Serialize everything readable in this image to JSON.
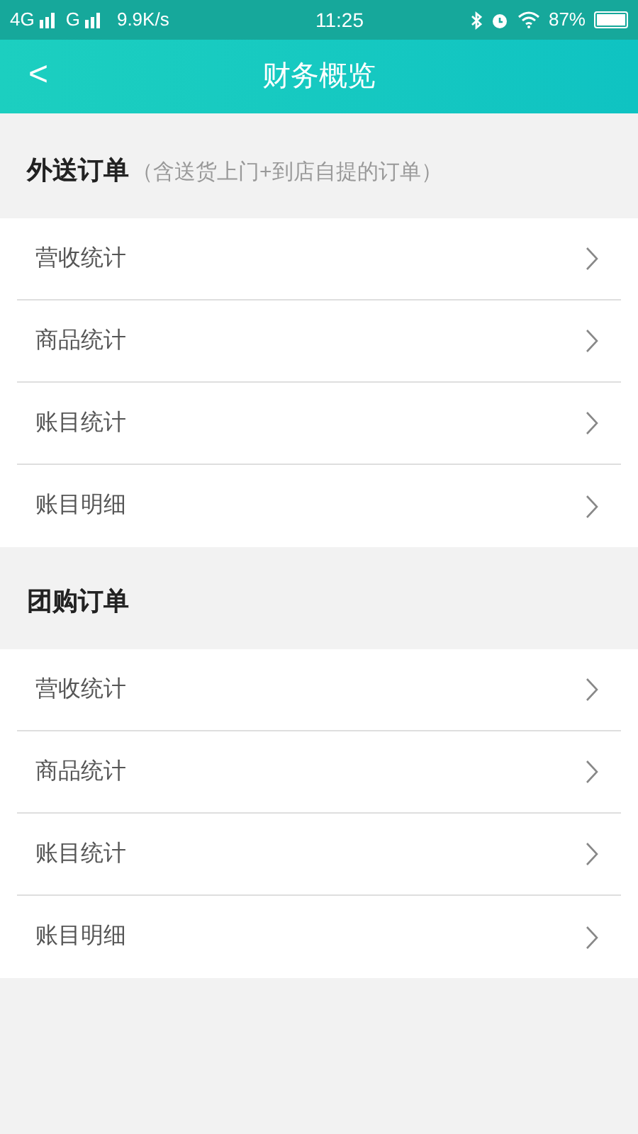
{
  "status_bar": {
    "network_1": "4G",
    "network_2": "G",
    "speed": "9.9K/s",
    "time": "11:25",
    "battery": "87%"
  },
  "header": {
    "back": "<",
    "title": "财务概览"
  },
  "sections": [
    {
      "title": "外送订单",
      "note": "（含送货上门+到店自提的订单）",
      "items": [
        "营收统计",
        "商品统计",
        "账目统计",
        "账目明细"
      ]
    },
    {
      "title": "团购订单",
      "items": [
        "营收统计",
        "商品统计",
        "账目统计",
        "账目明细"
      ]
    }
  ]
}
